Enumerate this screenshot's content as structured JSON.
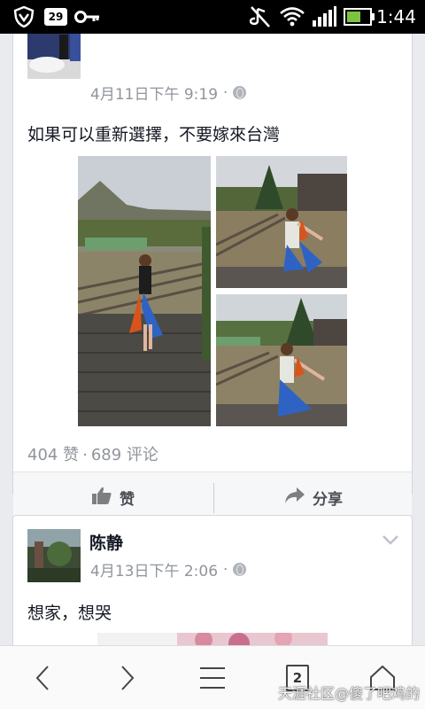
{
  "status_bar": {
    "time": "1:44",
    "notification_badge": "29",
    "icons": [
      "vpn-shield-icon",
      "notification-icon",
      "key-icon",
      "muted-icon",
      "wifi-icon",
      "signal-icon",
      "battery-icon"
    ]
  },
  "posts": [
    {
      "author": "",
      "timestamp": "4月11日下午 9:19",
      "separator": "·",
      "text": "如果可以重新選擇，不要嫁來台灣",
      "likes": "404 赞",
      "stats_sep": "·",
      "comments": "689 评论",
      "actions": {
        "like": "赞",
        "share": "分享"
      }
    },
    {
      "author": "陈静",
      "timestamp": "4月13日下午 2:06",
      "separator": "·",
      "text": "想家，想哭"
    }
  ],
  "browser_bar": {
    "tab_count": "2",
    "watermark": "天涯社区@傻了吧鸡的"
  },
  "colors": {
    "feed_bg": "#e9ebee",
    "text_primary": "#141823",
    "text_meta": "#90949c",
    "status_bar_bg": "#000000",
    "battery_green": "#7ec242"
  }
}
